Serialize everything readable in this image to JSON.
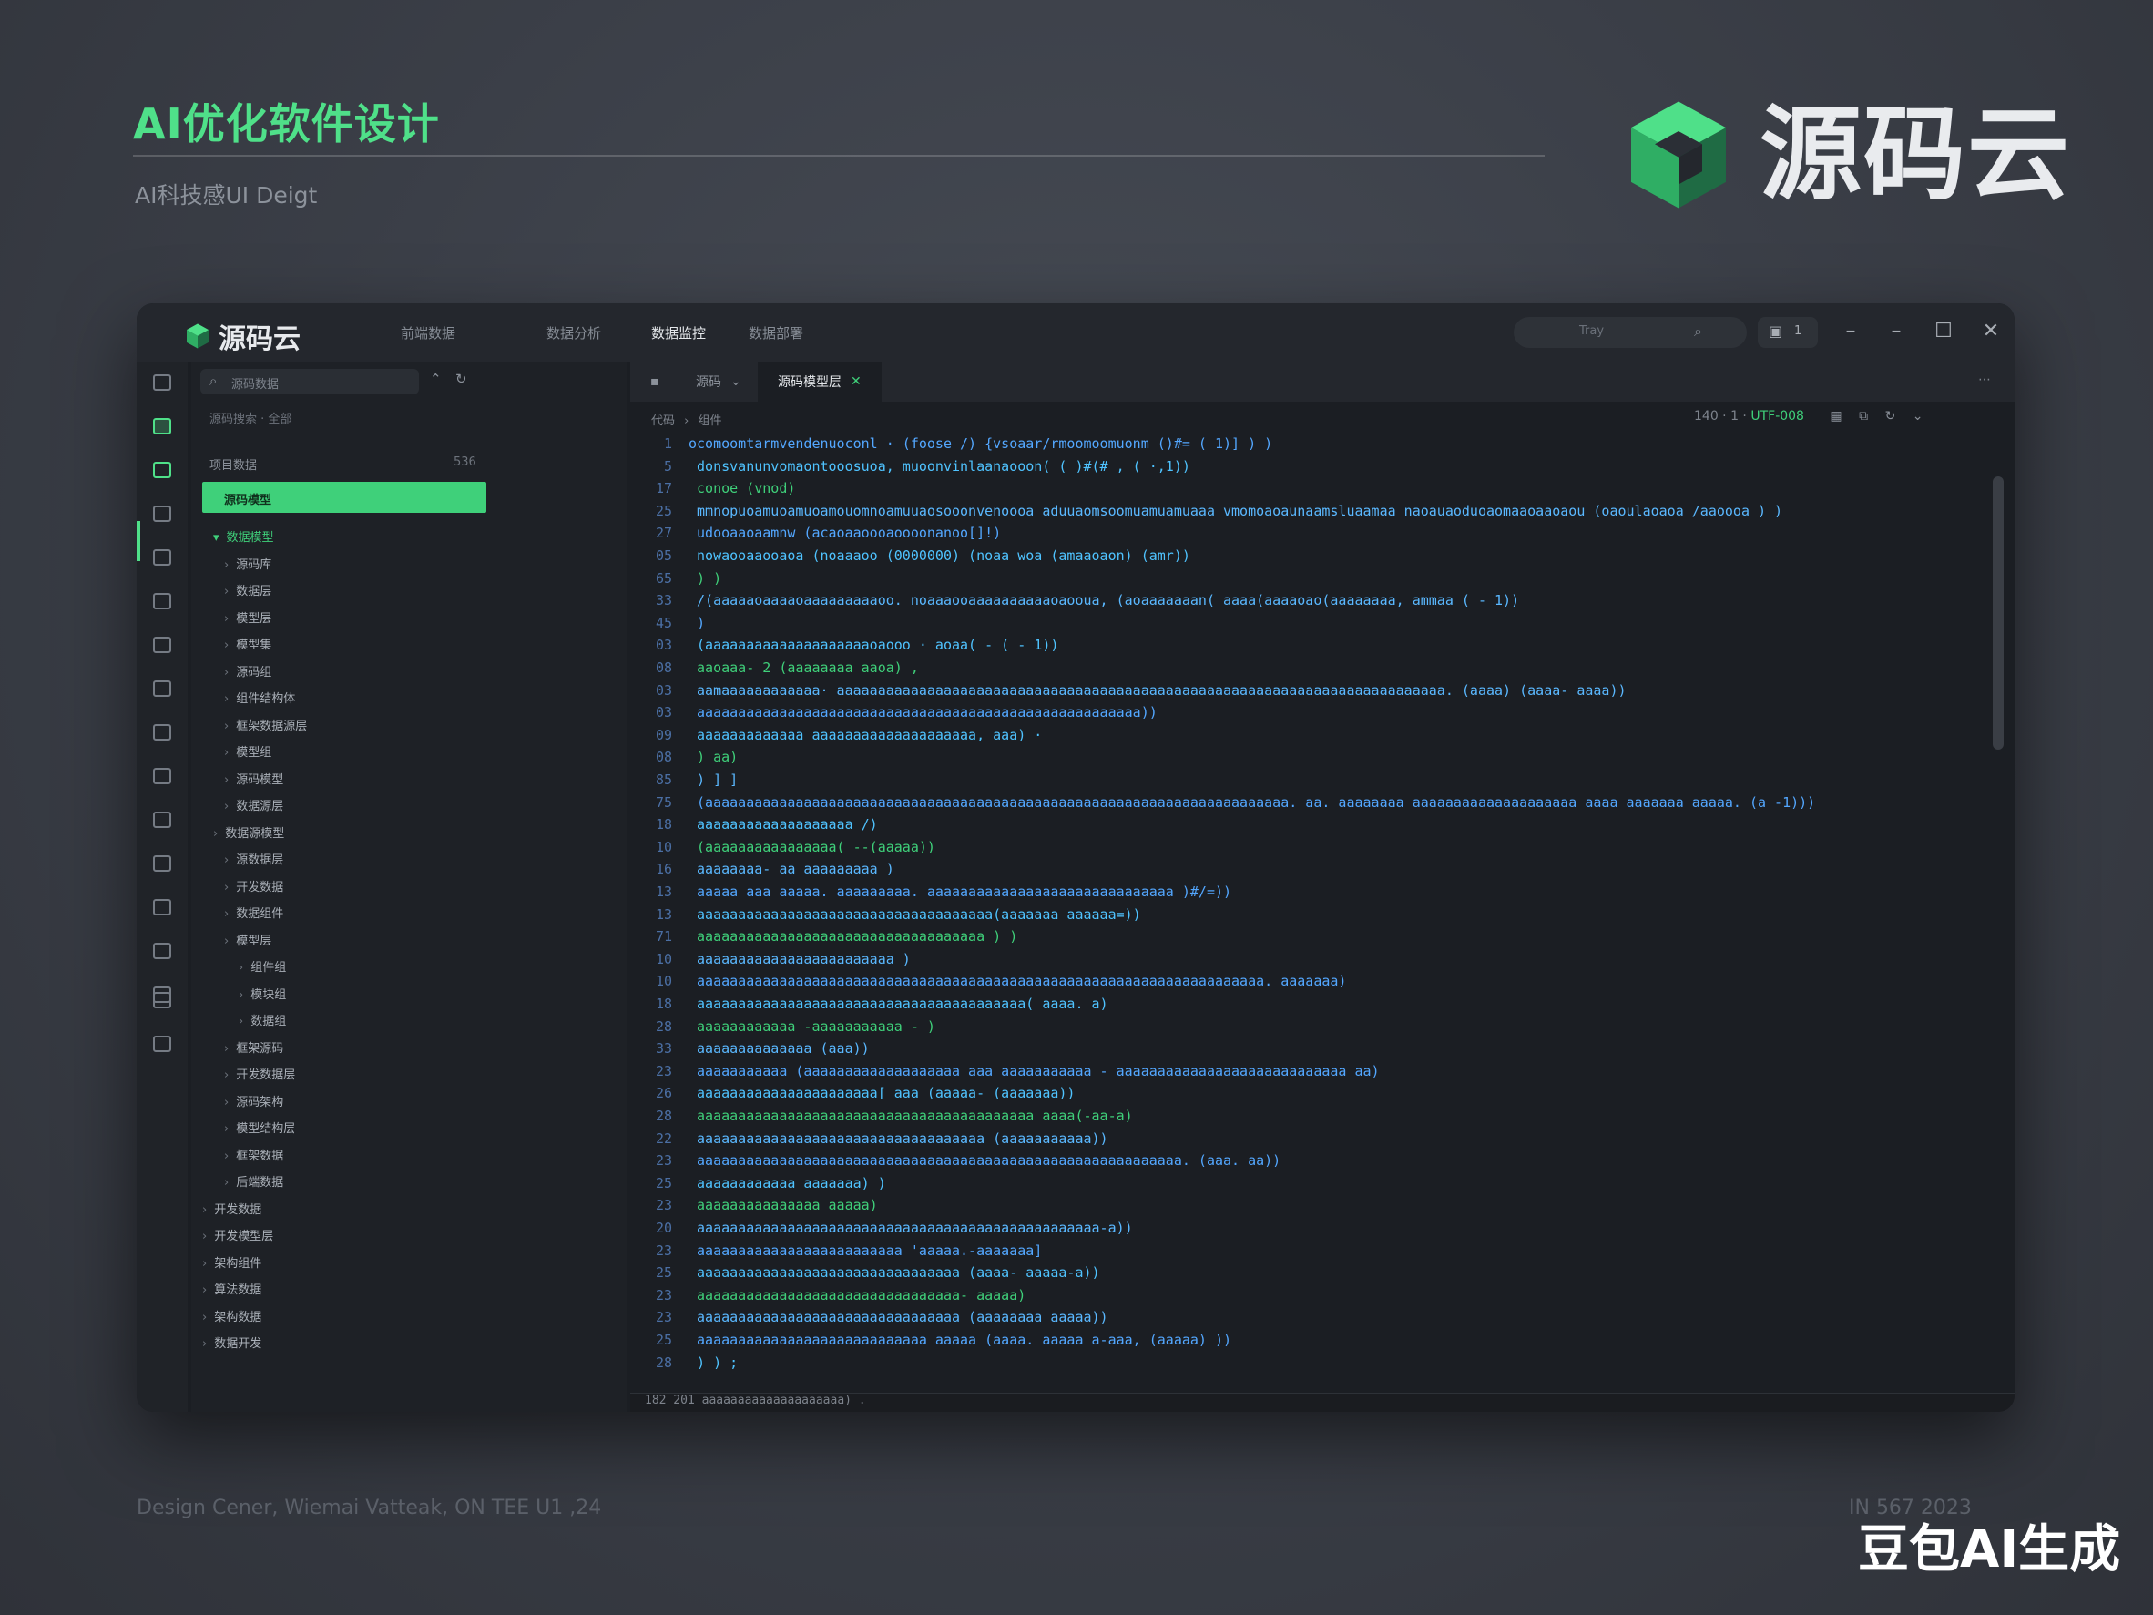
{
  "page": {
    "title": "AI优化软件设计",
    "subtitle": "AI科技感UI Deigt"
  },
  "brand": {
    "name": "源码云",
    "accent": "#3fd07a"
  },
  "window": {
    "logo_text": "源码云",
    "menu": [
      "前端数据",
      "数据分析",
      "数据监控",
      "数据部署"
    ],
    "search_placeholder": "Tray",
    "user_count": "1",
    "controls": [
      "–",
      "–",
      "☐",
      "✕"
    ],
    "activity_icons": [
      "file-icon",
      "code-icon",
      "explorer-icon",
      "git-icon",
      "debug-icon",
      "terminal-icon",
      "cloud-icon",
      "chart-icon",
      "package-icon",
      "database-icon",
      "monitor-icon",
      "server-icon",
      "search-icon",
      "sync-icon",
      "layers-icon",
      "settings-icon",
      "account-icon"
    ],
    "explorer": {
      "search_placeholder": "源码数据",
      "header": "源码搜索 · 全部",
      "section": "项目数据",
      "section_count": "536",
      "selected": "源码模型",
      "items": [
        "数据模型",
        "源码库",
        "数据层",
        "模型层",
        "模型集",
        "源码组",
        "组件结构体",
        "框架数据源层",
        "模型组",
        "源码模型",
        "数据源层",
        "数据源模型",
        "源数据层",
        "开发数据",
        "数据组件",
        "模型层",
        "组件组",
        "模块组",
        "数据组",
        "框架源码",
        "开发数据层",
        "源码架构",
        "模型结构层",
        "框架数据",
        "后端数据",
        "开发数据",
        "开发模型层",
        "架构组件",
        "算法数据",
        "架构数据",
        "数据开发"
      ]
    },
    "tabs": [
      "源码",
      "源码模型层"
    ],
    "breadcrumb": [
      "代码",
      "组件"
    ],
    "editor_info": "140 · 1 · ",
    "editor_info_accent": "UTF-008",
    "code_lines": [
      {
        "n": "1",
        "t": "ocomoomtarmvendenuoconl · (foose  /)           {vsoaar/rmoomoomuonm  ()#=  (  1)]           ) )"
      },
      {
        "n": "5",
        "t": "  donsvanunvomaontooosuoa, muoonvinlaanaooon(  (  )#(#  ,  (  ·,1))"
      },
      {
        "n": "17",
        "t": "    conoe  (vnod)"
      },
      {
        "n": "25",
        "t": "     mmnopuoamuoamuoamouomnoamuuaosooonvenoooa aduuaomsoomuamuamuaaa  vmomoaoaunaamsluaamaa  naoauaoduoaomaaoaaoaou  (oaoulaoaoa  /aaoooa ) )"
      },
      {
        "n": "27",
        "t": "      udooaaoaamnw  (acaoaaoooaoooonanoo[]!)"
      },
      {
        "n": "05",
        "t": "        nowaooaaooaoa  (noaaaoo  (0000000)  (noaa  woa  (amaaoaon)  (amr))"
      },
      {
        "n": "65",
        "t": "      )  )"
      },
      {
        "n": "33",
        "t": "      /(aaaaaoaaaaoaaaaaaaaaoo.  noaaaooaaaaaaaaaaoaooua, (aoaaaaaaan(  aaaa(aaaaoao(aaaaaaaa,  ammaa  (  - 1))"
      },
      {
        "n": "45",
        "t": "      )"
      },
      {
        "n": "03",
        "t": "      (aaaaaaaaaaaaaaaaaaaaoaooo · aoaa(  -  (  -  1))"
      },
      {
        "n": "08",
        "t": "        aaoaaa- 2    (aaaaaaaa  aaoa)  ,"
      },
      {
        "n": "03",
        "t": "        aamaaaaaaaaaaaa·  aaaaaaaaaaaaaaaaaaaaaaaaaaaaaaaaaaaaaaaaaaaaaaaaaaaaaaaaaaaaaaaaaaaaaaaaaa.  (aaaa)  (aaaa- aaaa))"
      },
      {
        "n": "03",
        "t": "        aaaaaaaaaaaaaaaaaaaaaaaaaaaaaaaaaaaaaaaaaaaaaaaaaaaaaa))"
      },
      {
        "n": "09",
        "t": "        aaaaaaaaaaaaa  aaaaaaaaaaaaaaaaaaaa,  aaa) ·"
      },
      {
        "n": "08",
        "t": "        ) aa)"
      },
      {
        "n": "85",
        "t": "    )  ]  ]"
      },
      {
        "n": "75",
        "t": "    (aaaaaaaaaaaaaaaaaaaaaaaaaaaaaaaaaaaaaaaaaaaaaaaaaaaaaaaaaaaaaaaaaaaaaaa.  aa. aaaaaaaa  aaaaaaaaaaaaaaaaaaaa aaaa aaaaaaa  aaaaa.  (a -1)))"
      },
      {
        "n": "18",
        "t": "      aaaaaaaaaaaaaaaaaaa  /)"
      },
      {
        "n": "10",
        "t": "       (aaaaaaaaaaaaaaaa(  --(aaaaa))"
      },
      {
        "n": "16",
        "t": "        aaaaaaaa-  aa  aaaaaaaaa    )"
      },
      {
        "n": "13",
        "t": "          aaaaa   aaa  aaaaa.  aaaaaaaaa.  aaaaaaaaaaaaaaaaaaaaaaaaaaaaaa  )#/=))"
      },
      {
        "n": "13",
        "t": "          aaaaaaaaaaaaaaaaaaaaaaaaaaaaaaaaaaaa(aaaaaaa  aaaaaa=))"
      },
      {
        "n": "71",
        "t": "          aaaaaaaaaaaaaaaaaaaaaaaaaaaaaaaaaaa  ) )"
      },
      {
        "n": "10",
        "t": "              aaaaaaaaaaaaaaaaaaaaaaaa  )"
      },
      {
        "n": "10",
        "t": "              aaaaaaaaaaaaaaaaaaaaaaaaaaaaaaaaaaaaaaaaaaaaaaaaaaaaaaaaaaaaaaaaaaaaa.  aaaaaaa)"
      },
      {
        "n": "18",
        "t": "              aaaaaaaaaaaaaaaaaaaaaaaaaaaaaaaaaaaaaaaa(  aaaa.  a)"
      },
      {
        "n": "28",
        "t": "              aaaaaaaaaaaa  -aaaaaaaaaaa  -  )"
      },
      {
        "n": "33",
        "t": "              aaaaaaaaaaaaaa  (aaa))"
      },
      {
        "n": "23",
        "t": "              aaaaaaaaaaa  (aaaaaaaaaaaaaaaaaaa  aaa  aaaaaaaaaaa  -  aaaaaaaaaaaaaaaaaaaaaaaaaaaa  aa)"
      },
      {
        "n": "26",
        "t": "              aaaaaaaaaaaaaaaaaaaaaa[  aaa  (aaaaa-  (aaaaaaa))"
      },
      {
        "n": "28",
        "t": "              aaaaaaaaaaaaaaaaaaaaaaaaaaaaaaaaaaaaaaaaa  aaaa(-aa-a)"
      },
      {
        "n": "22",
        "t": "              aaaaaaaaaaaaaaaaaaaaaaaaaaaaaaaaaaa  (aaaaaaaaaaa))"
      },
      {
        "n": "23",
        "t": "              aaaaaaaaaaaaaaaaaaaaaaaaaaaaaaaaaaaaaaaaaaaaaaaaaaaaaaaaaaa.  (aaa.  aa))"
      },
      {
        "n": "25",
        "t": "              aaaaaaaaaaaa  aaaaaaa)   )"
      },
      {
        "n": "23",
        "t": "              aaaaaaaaaaaaaaa  aaaaa)"
      },
      {
        "n": "20",
        "t": "              aaaaaaaaaaaaaaaaaaaaaaaaaaaaaaaaaaaaaaaaaaaaaaaaa-a))"
      },
      {
        "n": "23",
        "t": "              aaaaaaaaaaaaaaaaaaaaaaaaa  'aaaaa.-aaaaaaa]"
      },
      {
        "n": "25",
        "t": "              aaaaaaaaaaaaaaaaaaaaaaaaaaaaaaaa  (aaaa-  aaaaa-a))"
      },
      {
        "n": "23",
        "t": "              aaaaaaaaaaaaaaaaaaaaaaaaaaaaaaaa-  aaaaa)"
      },
      {
        "n": "23",
        "t": "              aaaaaaaaaaaaaaaaaaaaaaaaaaaaaaaa  (aaaaaaaa  aaaaa))"
      },
      {
        "n": "25",
        "t": "              aaaaaaaaaaaaaaaaaaaaaaaaaaaa  aaaaa  (aaaa.  aaaaa  a-aaa,  (aaaaa)  ))"
      },
      {
        "n": "28",
        "t": "          )  )   ;"
      }
    ],
    "status": "182  201       aaaaaaaaaaaaaaaaaaaa)  ."
  },
  "footer": {
    "left": "Design Cener, Wiemai Vatteak, ON TEE U1 ,24",
    "right": "IN 567 2023"
  },
  "watermark": "豆包AI生成"
}
